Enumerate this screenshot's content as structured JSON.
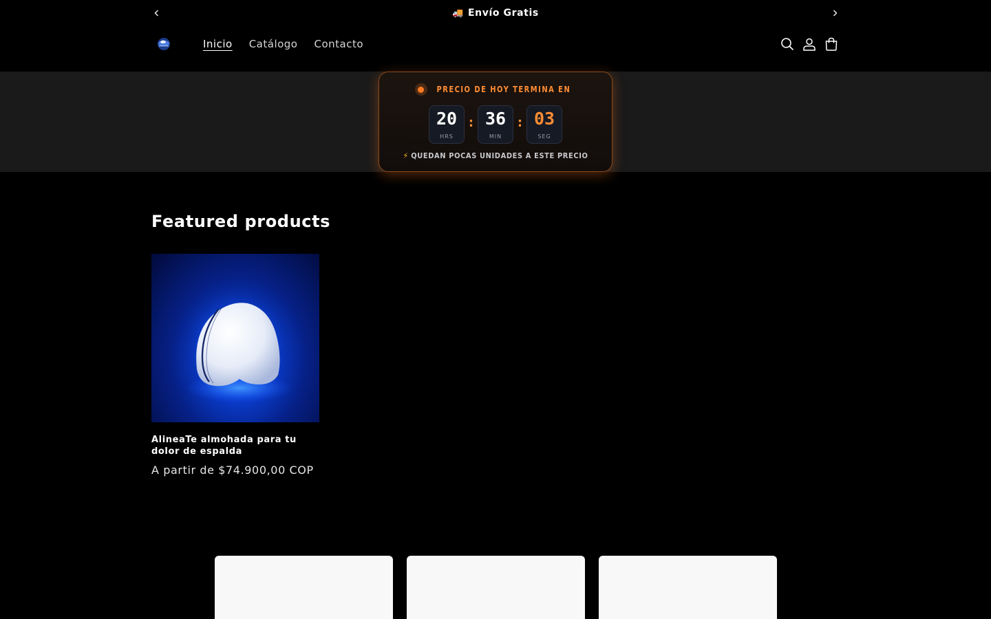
{
  "announcement": {
    "message": "Envío Gratis",
    "truck_icon": "🚚"
  },
  "header": {
    "nav": [
      {
        "label": "Inicio",
        "active": true
      },
      {
        "label": "Catálogo",
        "active": false
      },
      {
        "label": "Contacto",
        "active": false
      }
    ],
    "icons": [
      "search-icon",
      "account-icon",
      "cart-icon"
    ]
  },
  "countdown": {
    "heading": "PRECIO DE HOY TERMINA EN",
    "hours": "20",
    "hours_label": "HRS",
    "minutes": "36",
    "minutes_label": "MIN",
    "seconds": "03",
    "seconds_label": "SEG",
    "separator": ":",
    "footer_icon": "⚡",
    "footer": "QUEDAN POCAS UNIDADES A ESTE PRECIO",
    "accent_color": "#ff8c33"
  },
  "featured": {
    "title": "Featured products",
    "products": [
      {
        "name": "AlineaTe almohada para tu dolor de espalda",
        "price": "A partir de $74.900,00 COP"
      }
    ]
  }
}
